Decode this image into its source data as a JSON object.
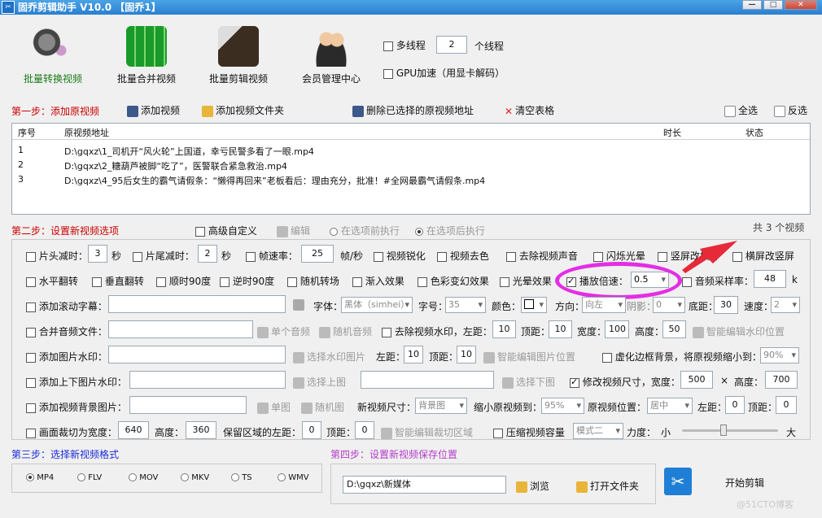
{
  "window": {
    "title": "固乔剪辑助手 V10.0 【固乔1】"
  },
  "toolbar": {
    "tools": [
      "批量转换视频",
      "批量合并视频",
      "批量剪辑视频",
      "会员管理中心"
    ],
    "multithread_label": "多线程",
    "thread_count": "2",
    "thread_unit": "个线程",
    "gpu_label": "GPU加速（用显卡解码）"
  },
  "step1": {
    "title": "第一步：添加原视频",
    "add_video": "添加视频",
    "add_folder": "添加视频文件夹",
    "delete_selected": "删除已选择的原视频地址",
    "clear_table": "清空表格",
    "select_all": "全选",
    "invert": "反选"
  },
  "table": {
    "headers": [
      "序号",
      "原视频地址",
      "时长",
      "状态"
    ],
    "rows": [
      {
        "n": "1",
        "path": "D:\\gqxz\\1_司机开“风火轮”上国道，幸亏民警多看了一眼.mp4"
      },
      {
        "n": "2",
        "path": "D:\\gqxz\\2_糖葫芦被脚“吃了”，医警联合紧急救治.mp4"
      },
      {
        "n": "3",
        "path": "D:\\gqxz\\4_95后女生的霸气请假条：“懒得再回来”老板看后：理由充分，批准！#全网最霸气请假条.mp4"
      }
    ]
  },
  "step2": {
    "title": "第二步：设置新视频选项",
    "advanced": "高级自定义",
    "edit": "编辑",
    "before_exec": "在选项前执行",
    "after_exec": "在选项后执行",
    "count_text": "共 3 个视频"
  },
  "options": {
    "row1": {
      "head_cut": "片头减时：",
      "head_val": "3",
      "sec": "秒",
      "tail_cut": "片尾减时：",
      "tail_val": "2",
      "fps": "帧速率：",
      "fps_val": "25",
      "fps_unit": "帧/秒",
      "sharpen": "视频锐化",
      "decolor": "视频去色",
      "mute": "去除视频声音",
      "flash": "闪烁光晕",
      "v2h": "竖屏改横屏",
      "h2v": "横屏改竖屏"
    },
    "row2": {
      "hflip": "水平翻转",
      "vflip": "垂直翻转",
      "cw90": "顺时90度",
      "ccw90": "逆时90度",
      "random_trans": "随机转场",
      "fadein": "渐入效果",
      "color_fx": "色彩变幻效果",
      "glow": "光晕效果",
      "speed": "播放倍速：",
      "speed_val": "0.5",
      "sample_rate": "音频采样率：",
      "sample_val": "48",
      "sample_unit": "k"
    },
    "row3": {
      "scroll_sub": "添加滚动字幕：",
      "font": "字体：",
      "font_val": "黑体（simhei）",
      "size": "字号：",
      "size_val": "35",
      "color": "颜色：",
      "direction": "方向：",
      "dir_val": "向左",
      "shadow": "阴影：",
      "shadow_val": "0",
      "bottom": "底距：",
      "bottom_val": "30",
      "spd": "速度：",
      "spd_val": "2"
    },
    "row4": {
      "merge_audio": "合并音频文件：",
      "single_audio": "单个音频",
      "random_audio": "随机音频",
      "remove_wm": "去除视频水印，左距：",
      "left_val": "10",
      "top": "顶距：",
      "top_val": "10",
      "width": "宽度：",
      "width_val": "100",
      "height": "高度：",
      "height_val": "50",
      "smart_wm": "智能编辑水印位置"
    },
    "row5": {
      "img_wm": "添加图片水印：",
      "choose_wm": "选择水印图片",
      "left": "左距：",
      "left_val": "10",
      "top": "顶距：",
      "top_val": "10",
      "smart_img": "智能编辑图片位置",
      "blur_border": "虚化边框背景，将原视频缩小到：",
      "blur_val": "90%"
    },
    "row6": {
      "tb_wm": "添加上下图片水印：",
      "choose_top": "选择上图",
      "choose_bottom": "选择下图",
      "resize": "修改视频尺寸，宽度：",
      "w_val": "500",
      "times": "×",
      "h": "高度：",
      "h_val": "700"
    },
    "row7": {
      "bg_img": "添加视频背景图片：",
      "single": "单图",
      "random": "随机图",
      "new_size": "新视频尺寸：",
      "new_size_val": "背景图",
      "shrink": "缩小原视频到：",
      "shrink_val": "95%",
      "pos": "原视频位置：",
      "pos_val": "居中",
      "left": "左距：",
      "left_val": "0",
      "top": "顶距：",
      "top_val": "0"
    },
    "row8": {
      "crop": "画面裁切为宽度：",
      "crop_w": "640",
      "height": "高度：",
      "crop_h": "360",
      "keep_left": "保留区域的左距：",
      "keep_left_val": "0",
      "top": "顶距：",
      "top_val": "0",
      "smart_crop": "智能编辑裁切区域",
      "compress": "压缩视频容量",
      "mode_val": "模式二",
      "strength": "力度：",
      "small": "小",
      "big": "大"
    }
  },
  "step3": {
    "title": "第三步：选择新视频格式",
    "formats": [
      "MP4",
      "FLV",
      "MOV",
      "MKV",
      "TS",
      "WMV"
    ]
  },
  "step4": {
    "title": "第四步：设置新视频保存位置",
    "path": "D:\\gqxz\\新媒体",
    "browse": "浏览",
    "open_folder": "打开文件夹",
    "start": "开始剪辑"
  },
  "watermark": "@51CTO博客"
}
